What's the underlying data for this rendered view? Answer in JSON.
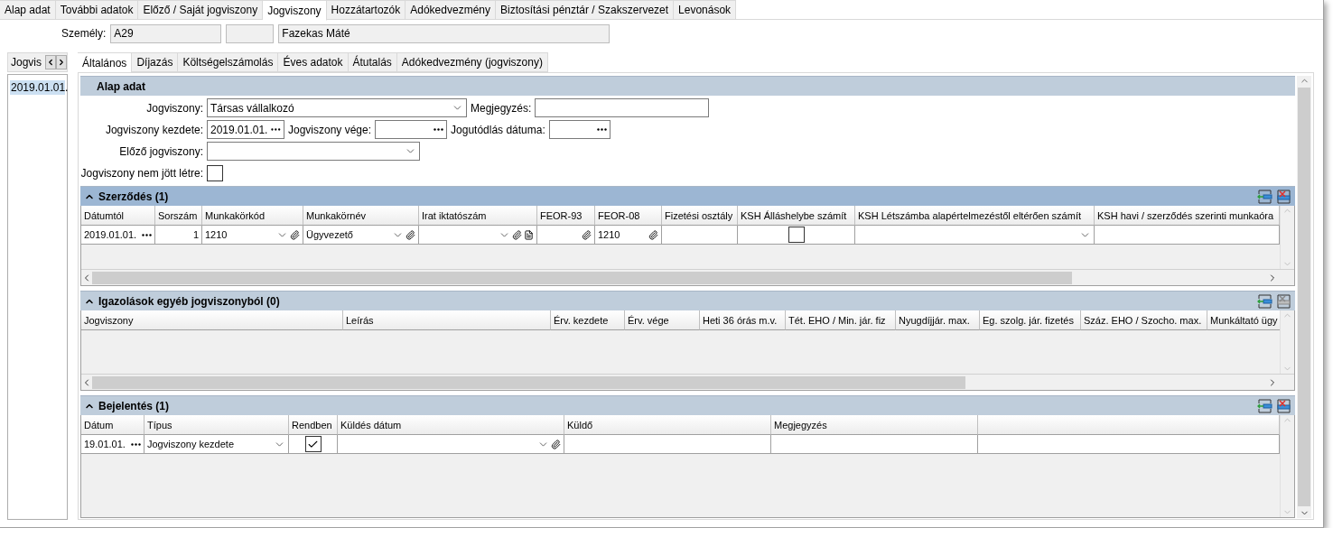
{
  "top_tabs": [
    {
      "label": "Alap adat",
      "selected": false
    },
    {
      "label": "További adatok",
      "selected": false
    },
    {
      "label": "Előző / Saját jogviszony",
      "selected": false
    },
    {
      "label": "Jogviszony",
      "selected": true
    },
    {
      "label": "Hozzátartozók",
      "selected": false
    },
    {
      "label": "Adókedvezmény",
      "selected": false
    },
    {
      "label": "Biztosítási pénztár / Szakszervezet",
      "selected": false
    },
    {
      "label": "Levonások",
      "selected": false
    }
  ],
  "person": {
    "label": "Személy:",
    "code": "A29",
    "name": "Fazekas Máté"
  },
  "side_list": {
    "header": "Jogvis",
    "items": [
      {
        "label": "2019.01.01.",
        "selected": true
      }
    ]
  },
  "inner_tabs": [
    {
      "label": "Általános",
      "selected": true
    },
    {
      "label": "Díjazás",
      "selected": false
    },
    {
      "label": "Költségelszámolás",
      "selected": false
    },
    {
      "label": "Éves adatok",
      "selected": false
    },
    {
      "label": "Átutalás",
      "selected": false
    },
    {
      "label": "Adókedvezmény (jogviszony)",
      "selected": false
    }
  ],
  "basic": {
    "title": "Alap adat",
    "rows": [
      {
        "fields": [
          {
            "label": "Jogviszony:",
            "kind": "combo",
            "value": "Társas vállalkozó"
          },
          {
            "label": "Megjegyzés:",
            "kind": "text"
          }
        ]
      },
      {
        "fields": [
          {
            "label": "Jogviszony kezdete:",
            "kind": "date",
            "value": "2019.01.01."
          },
          {
            "label": "Jogviszony vége:",
            "kind": "date"
          },
          {
            "label": "Jogutódlás dátuma:",
            "kind": "date"
          }
        ]
      },
      {
        "fields": [
          {
            "label": "Előző jogviszony:",
            "kind": "combo"
          }
        ]
      },
      {
        "fields": [
          {
            "label": "Jogviszony nem jött létre:",
            "kind": "checkbox",
            "checked": false
          }
        ]
      }
    ]
  },
  "grids": [
    {
      "title": "Szerződés (1)",
      "expanded": true,
      "focused": true,
      "delete_enabled": true,
      "columns": [
        "Dátumtól",
        "Sorszám",
        "Munkakörkód",
        "Munkakörnév",
        "Irat iktatószám",
        "FEOR-93",
        "FEOR-08",
        "Fizetési osztály",
        "KSH Álláshelybe számít",
        "KSH Létszámba alapértelmezéstől eltérően számít",
        "KSH havi / szerződés szerinti munkaóra"
      ],
      "rows": [
        [
          {
            "kind": "date",
            "value": "2019.01.01."
          },
          {
            "kind": "number",
            "value": "1"
          },
          {
            "kind": "combo_clip",
            "value": "1210"
          },
          {
            "kind": "combo_clip",
            "value": "Ügyvezető"
          },
          {
            "kind": "combo_clip_doc"
          },
          {
            "kind": "clip"
          },
          {
            "kind": "clip",
            "value": "1210"
          },
          {
            "kind": "text"
          },
          {
            "kind": "checkbox",
            "checked": false
          },
          {
            "kind": "combo"
          },
          {
            "kind": "text"
          }
        ]
      ]
    },
    {
      "title": "Igazolások egyéb jogviszonyból (0)",
      "expanded": true,
      "focused": false,
      "delete_enabled": false,
      "columns": [
        "Jogviszony",
        "Leírás",
        "Érv. kezdete",
        "Érv. vége",
        "Heti 36 órás m.v.",
        "Tét. EHO / Min. jár. fiz",
        "Nyugdíjjár. max.",
        "Eg. szolg. jár. fizetés",
        "Száz. EHO / Szocho. max.",
        "Munkáltató ügy"
      ]
    },
    {
      "title": "Bejelentés (1)",
      "expanded": true,
      "focused": false,
      "delete_enabled": true,
      "columns": [
        "Dátum",
        "Típus",
        "Rendben",
        "Küldés dátum",
        "Küldő",
        "Megjegyzés"
      ],
      "rows": [
        [
          {
            "kind": "date",
            "value": "19.01.01."
          },
          {
            "kind": "combo",
            "value": "Jogviszony kezdete"
          },
          {
            "kind": "checkbox",
            "checked": true
          },
          {
            "kind": "combo_clip"
          },
          {
            "kind": "text"
          },
          {
            "kind": "text"
          }
        ]
      ]
    }
  ]
}
